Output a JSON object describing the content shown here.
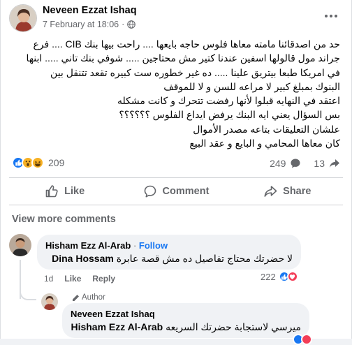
{
  "post": {
    "author": "Neveen Ezzat Ishaq",
    "date": "7 February at 18:06",
    "date_suffix": "·",
    "privacy_icon": "globe-icon",
    "body_lines": [
      "حد من اصدقائنا مامته معاها فلوس حاجه بايعها .... راحت بيها بنك CIB .... فرع",
      "جراند مول قالولها اسفين عندنا كتير مش محتاجين ..... شوفي بنك تاني ..... ابنها",
      "في امريكا طبعا بيتريق علينا ..... ده غير خطوره ست كبيره تقعد تتنقل بين",
      "البنوك بمبلغ كبير لا مراعه للسن و لا للموقف",
      "اعتقد في النهايه قبلوا لأنها رفضت تتحرك و كانت مشكله",
      "بس السؤال يعني ايه البنك يرفض ايداع الفلوس ؟؟؟؟؟؟",
      "علشان التعليقات بتاعه مصدر الأموال",
      "كان معاها المحامي و البايع و عقد البيع"
    ],
    "reaction_count": "209",
    "comment_count": "249",
    "share_count": "13",
    "reaction_icons": [
      "like",
      "wow",
      "haha"
    ]
  },
  "actions": {
    "like": "Like",
    "comment": "Comment",
    "share": "Share"
  },
  "comments": {
    "view_more": "View more comments",
    "c1": {
      "name": "Hisham Ezz Al-Arab",
      "separator": "·",
      "follow": "Follow",
      "mention": "Dina Hossam",
      "text": "لا حضرتك محتاج تفاصيل ده مش قصة عابرة",
      "time": "1d",
      "like": "Like",
      "reply": "Reply",
      "reaction_count": "222"
    },
    "c2": {
      "badge": "Author",
      "name": "Neveen Ezzat Ishaq",
      "mention": "Hisham Ezz Al-Arab",
      "text": "ميرسي لاستجابة حضرتك السريعه"
    }
  },
  "colors": {
    "accent": "#1877f2",
    "muted": "#65676b",
    "love": "#f33e58",
    "wow": "#f7b125"
  }
}
